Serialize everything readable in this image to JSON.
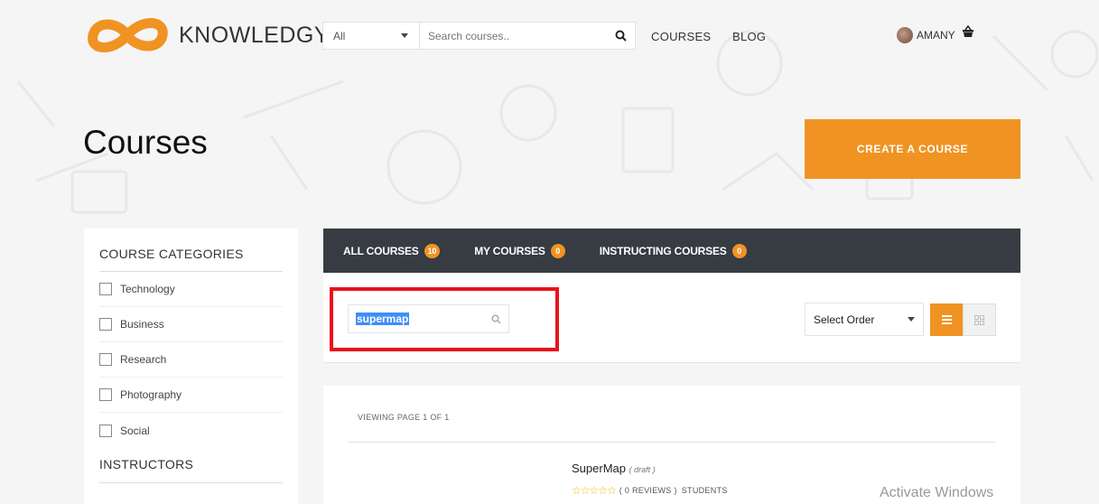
{
  "header": {
    "brand": "KNOWLEDGY",
    "search_category": "All",
    "search_placeholder": "Search courses..",
    "nav": [
      "COURSES",
      "BLOG"
    ],
    "user_name": "AMANY"
  },
  "page": {
    "title": "Courses",
    "create_button": "CREATE A COURSE"
  },
  "sidebar": {
    "categories_heading": "COURSE CATEGORIES",
    "categories": [
      "Technology",
      "Business",
      "Research",
      "Photography",
      "Social"
    ],
    "instructors_heading": "INSTRUCTORS"
  },
  "tabs": [
    {
      "label": "ALL COURSES",
      "count": "10"
    },
    {
      "label": "MY COURSES",
      "count": "0"
    },
    {
      "label": "INSTRUCTING COURSES",
      "count": "0"
    }
  ],
  "filter": {
    "search_value": "supermap",
    "order_label": "Select Order"
  },
  "results": {
    "viewing": "VIEWING PAGE 1 OF 1",
    "course": {
      "title": "SuperMap",
      "status": "( draft )",
      "stars": "☆☆☆☆☆",
      "reviews": "( 0 REVIEWS )",
      "students": "STUDENTS"
    }
  },
  "os_watermark": "Activate Windows",
  "colors": {
    "accent": "#f09322",
    "tabs_bg": "#363c41",
    "highlight": "#e8121b",
    "selection": "#3f8ef7"
  },
  "icons": [
    "logo-infinity-icon",
    "caret-down-icon",
    "search-icon",
    "avatar",
    "basket-icon",
    "list-view-icon",
    "grid-view-icon",
    "star-icon"
  ]
}
